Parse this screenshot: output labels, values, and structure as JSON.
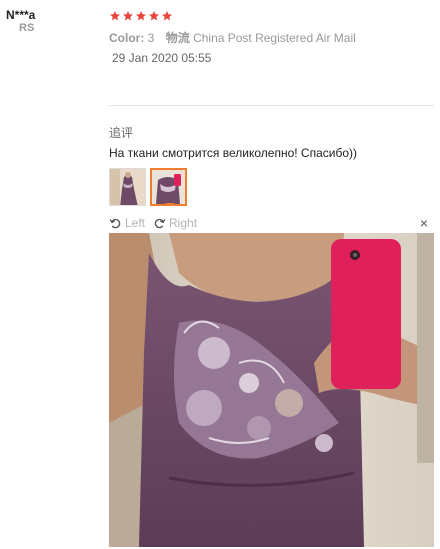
{
  "user": {
    "name": "N***a",
    "country": "RS"
  },
  "review": {
    "rating": 5,
    "color_label": "Color:",
    "color_value": "3",
    "shipping_label": "物流",
    "shipping_value": "China Post Registered Air Mail",
    "date": "29 Jan 2020 05:55"
  },
  "followup": {
    "title": "追评",
    "text": "На ткани смотрится великолепно! Спасибо))"
  },
  "viewer": {
    "left_label": "Left",
    "right_label": "Right",
    "close_glyph": "×"
  },
  "icons": {
    "star": "star-icon",
    "rotate_left": "rotate-left-icon",
    "rotate_right": "rotate-right-icon",
    "close": "close-icon"
  },
  "colors": {
    "star": "#e8463d",
    "accent": "#f07c2e",
    "dress": "#6e4a66"
  }
}
